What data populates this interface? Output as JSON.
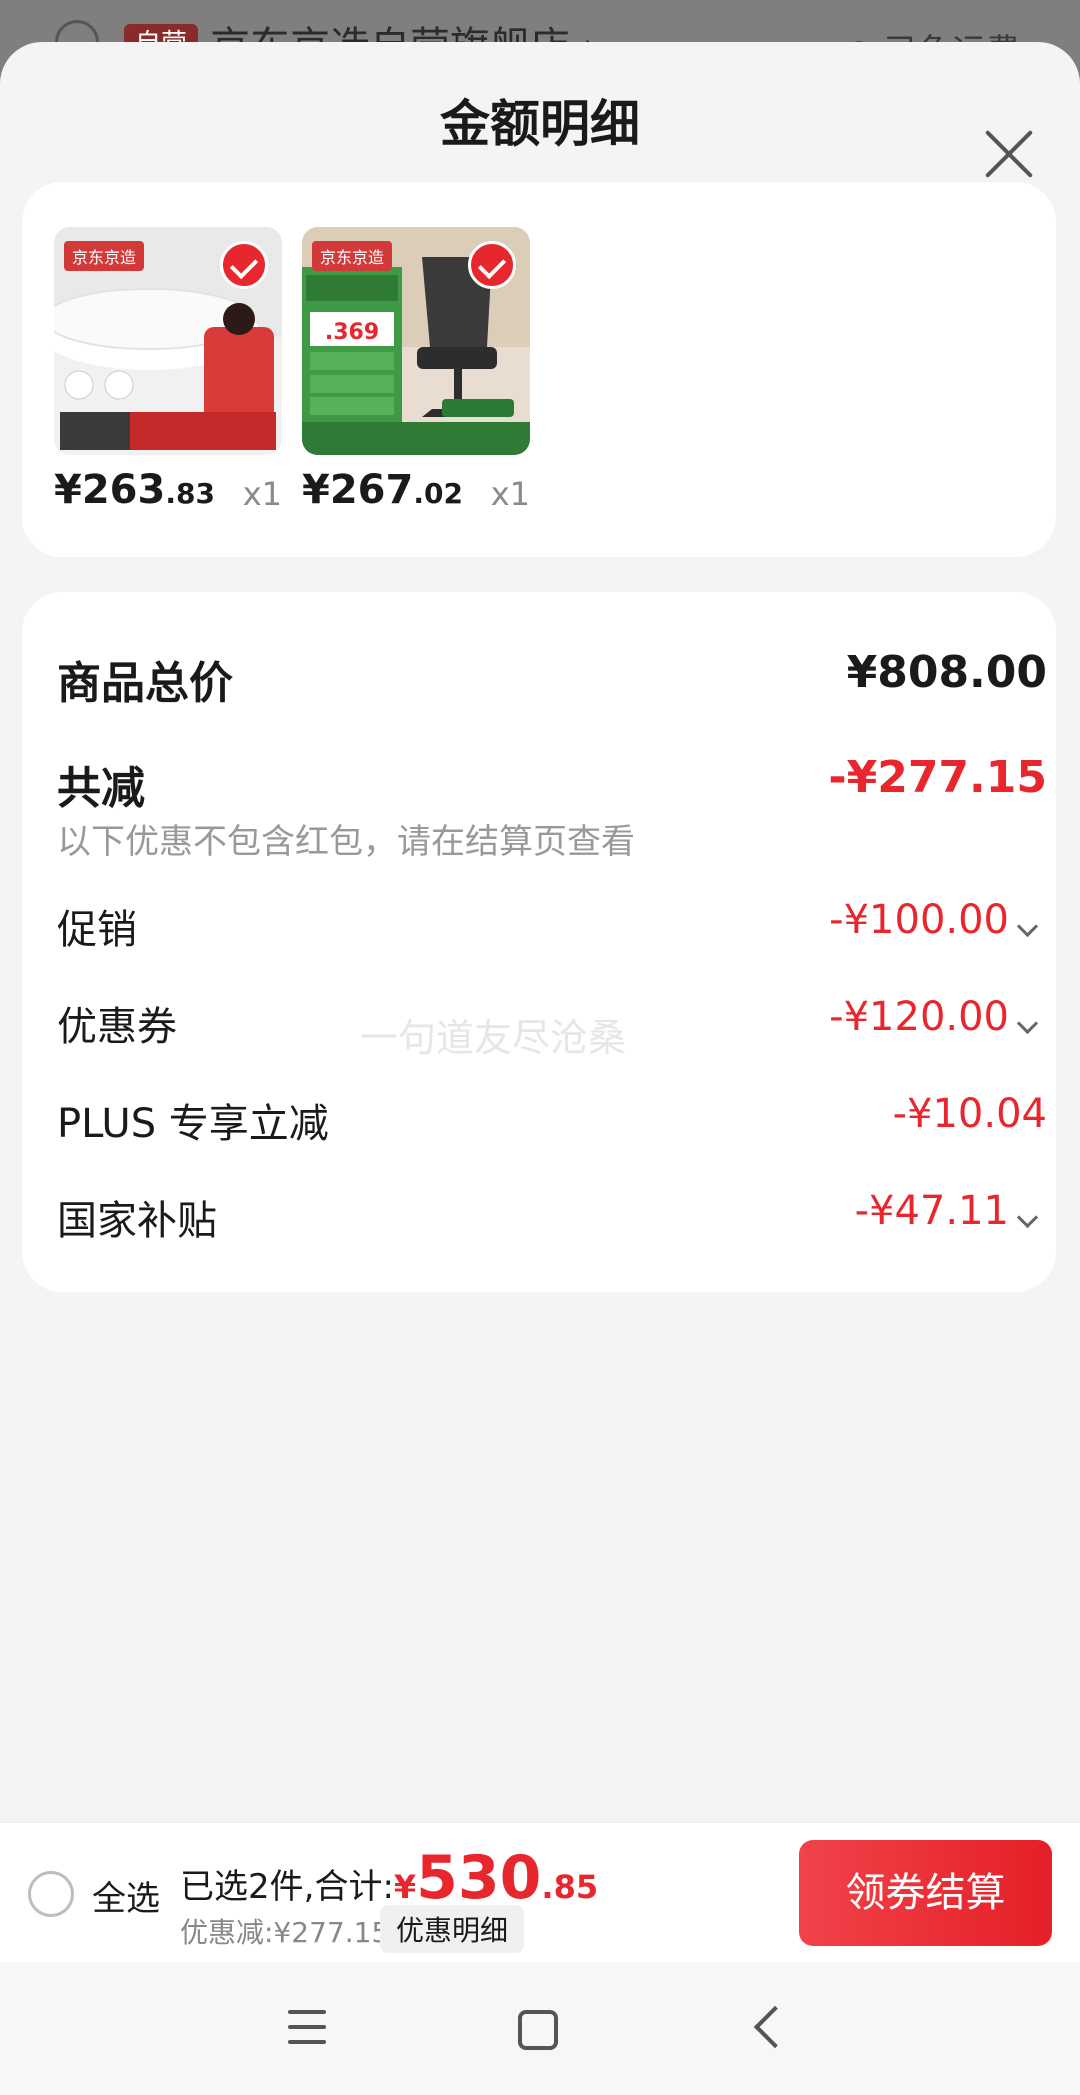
{
  "background": {
    "tag": "自营",
    "store_name": "京东京造自营旗舰店 ›",
    "freight": "⊙ 已免运费"
  },
  "sheet": {
    "title": "金额明细"
  },
  "products": [
    {
      "brand": "京东京造",
      "price_int": "¥263",
      "price_dec": ".83",
      "qty": "x1"
    },
    {
      "brand": "京东京造",
      "price_int": "¥267",
      "price_dec": ".02",
      "qty": "x1"
    }
  ],
  "totals": {
    "goods_total_label": "商品总价",
    "goods_total_value": "¥808.00",
    "reduction_label": "共减",
    "reduction_value": "-¥277.15",
    "note": "以下优惠不包含红包，请在结算页查看",
    "items": [
      {
        "label": "促销",
        "value": "-¥100.00"
      },
      {
        "label": "优惠券",
        "value": "-¥120.00"
      },
      {
        "label": "PLUS 专享立减",
        "value": "-¥10.04"
      },
      {
        "label": "国家补贴",
        "value": "-¥47.11"
      }
    ]
  },
  "watermark": "一句道友尽沧桑",
  "bottom": {
    "select_all": "全选",
    "summary_prefix": "已选2件,合计:",
    "yen": "¥",
    "total_int": "530",
    "total_dec": ".85",
    "discount": "优惠减:¥277.15",
    "detail_button": "优惠明细",
    "checkout_button": "领券结算"
  },
  "colors": {
    "accent": "#e8262d",
    "sheet_bg": "#f4f4f4",
    "card_bg": "#ffffff"
  }
}
